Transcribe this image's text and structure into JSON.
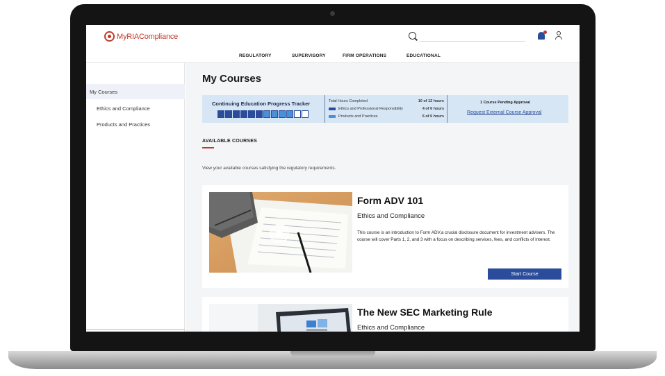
{
  "header": {
    "logo_text": "MyRIACompliance",
    "search_placeholder": ""
  },
  "nav": [
    "REGULATORY",
    "SUPERVISORY",
    "FIRM OPERATIONS",
    "EDUCATIONAL"
  ],
  "sidebar": {
    "items": [
      {
        "label": "My Courses",
        "active": true
      },
      {
        "label": "Ethics and Compliance",
        "active": false
      },
      {
        "label": "Products and Practices",
        "active": false
      }
    ]
  },
  "main": {
    "title": "My Courses",
    "tracker": {
      "title": "Continuing Education Progress Tracker",
      "segments_total": 12,
      "segments_filled": 10,
      "total_label": "Total Hours Completed",
      "total_value": "10 of 12 hours",
      "rows": [
        {
          "label": "Ethics and Professional Responsibility",
          "value": "4 of 6 hours",
          "color": "#2b4c9b"
        },
        {
          "label": "Products and Practices",
          "value": "6 of 6 hours",
          "color": "#4a90d9"
        }
      ],
      "pending": "1 Course Pending Approval",
      "approval_link": "Request External Course Approval"
    },
    "section_label": "AVAILABLE COURSES",
    "section_desc": "View your available courses satisfying the regulatory requirements.",
    "courses": [
      {
        "title": "Form ADV 101",
        "category": "Ethics and Compliance",
        "description": "This course is an introduction to Form ADV,a crucial disclosure document for investment advisers. The course will cover Parts 1, 2, and 3 with a focus on describing services, fees, and conflicts of interest.",
        "button": "Start Course"
      },
      {
        "title": "The New SEC Marketing Rule",
        "category": "Ethics and Compliance"
      }
    ]
  },
  "colors": {
    "brand_red": "#c0392b",
    "primary_blue": "#2b4c9b",
    "light_blue": "#4a90d9",
    "tracker_bg": "#d7e6f5"
  }
}
